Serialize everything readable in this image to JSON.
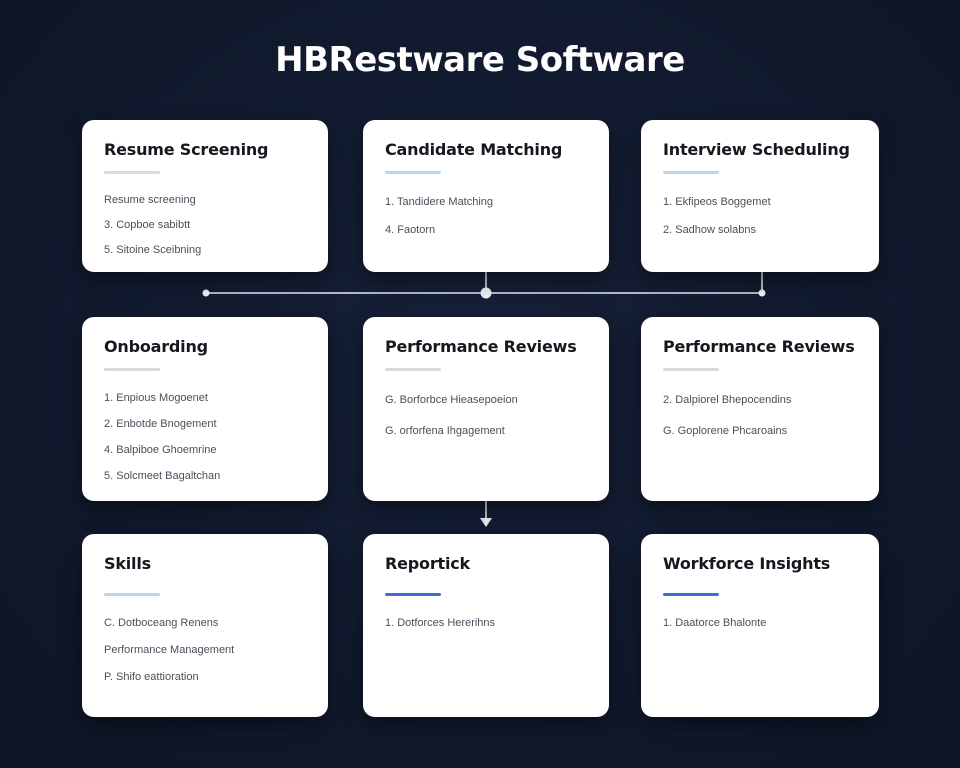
{
  "title": "HBRestware Software",
  "cards": [
    {
      "title": "Resume Screening",
      "items": [
        "Resume screening",
        "3. Copboe sabibtt",
        "5. Sitoine Sceibning"
      ]
    },
    {
      "title": "Candidate Matching",
      "items": [
        "1. Tandidere Matching",
        "4. Faotorn"
      ]
    },
    {
      "title": "Interview Scheduling",
      "items": [
        "1. Ekfipeos Boggemet",
        "2. Sadhow solabns"
      ]
    },
    {
      "title": "Onboarding",
      "items": [
        "1. Enpious Mogoenet",
        "2. Enbotde Bnogement",
        "4. Balpiboe Ghoemrine",
        "5. Solcmeet Bagaltchan"
      ]
    },
    {
      "title": "Performance Reviews",
      "items": [
        "G. Borforbce Hieasepoeion",
        "G. orforfena Ihgagement"
      ]
    },
    {
      "title": "Performance Reviews",
      "items": [
        "2. Dalpiorel Bhepocendins",
        "G. Goplorene Phcaroains"
      ]
    },
    {
      "title": "Skills",
      "items": [
        "C. Dotboceang Renens",
        "Performance Management",
        "P. Shifo eattioration"
      ]
    },
    {
      "title": "Reportick",
      "items": [
        "1. Dotforces Hererihns"
      ]
    },
    {
      "title": "Workforce Insights",
      "items": [
        "1. Daatorce Bhalonte"
      ]
    }
  ]
}
